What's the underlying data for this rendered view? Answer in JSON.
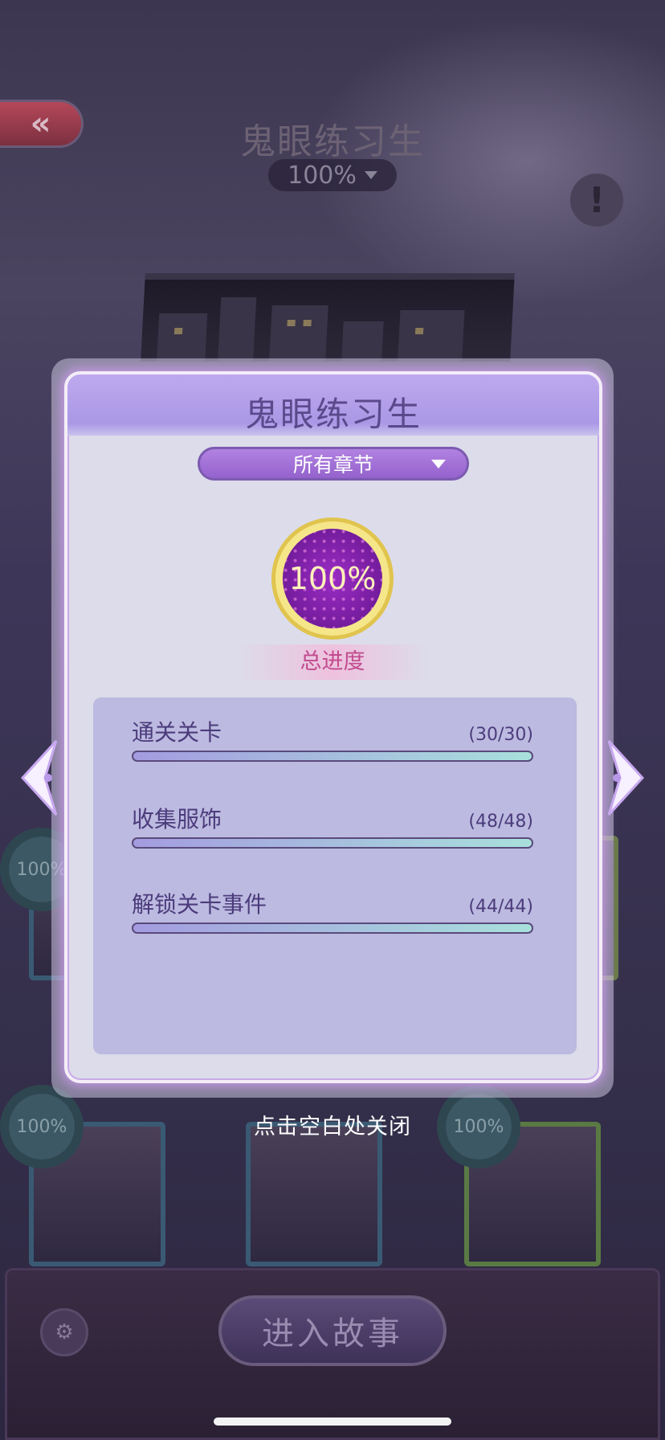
{
  "background": {
    "title": "鬼眼练习生",
    "progress_display": "100%",
    "badges": [
      "100%",
      "100%",
      "100%",
      "100%"
    ]
  },
  "modal": {
    "title": "鬼眼练习生",
    "chapter_filter": "所有章节",
    "total_progress_value": "100%",
    "total_progress_label": "总进度",
    "stats": [
      {
        "label": "通关关卡",
        "count": "(30/30)",
        "fraction": 1.0
      },
      {
        "label": "收集服饰",
        "count": "(48/48)",
        "fraction": 1.0
      },
      {
        "label": "解锁关卡事件",
        "count": "(44/44)",
        "fraction": 1.0
      }
    ]
  },
  "close_hint": "点击空白处关闭",
  "enter_story_label": "进入故事",
  "icons": {
    "back": "double-chevron-left-icon",
    "info": "exclamation-icon",
    "prev": "arrow-left-icon",
    "next": "arrow-right-icon",
    "book": "book-settings-icon"
  },
  "colors": {
    "modal_accent": "#a898e6",
    "progress_gold": "#e0c44e",
    "progress_purple": "#7a1ea8",
    "total_label_pink": "#c24a8e"
  }
}
